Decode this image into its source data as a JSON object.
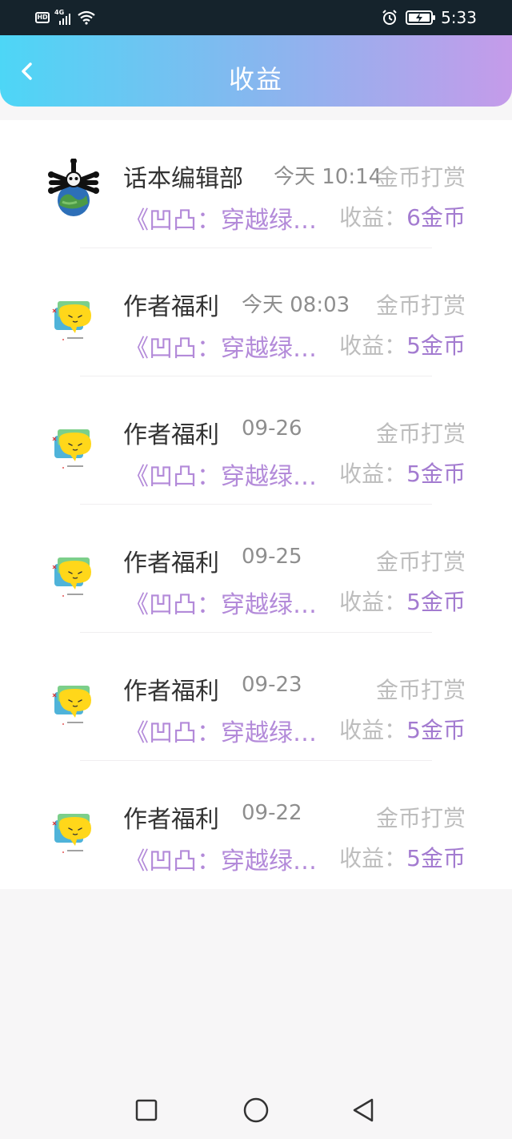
{
  "status_bar": {
    "hd_label": "HD",
    "network_label": "4G",
    "time": "5:33"
  },
  "header": {
    "title": "收益",
    "back_icon": "chevron-left-icon",
    "gradient": [
      "#4dd6f6",
      "#c59bea"
    ]
  },
  "rows": [
    {
      "name": "话本编辑部",
      "time": "今天 10:14",
      "type": "金币打赏",
      "book": "《凹凸：穿越绿林》",
      "income_label": "收益：",
      "income_amount": "6金币",
      "avatar": "skull-globe-avatar"
    },
    {
      "name": "作者福利",
      "time": "今天 08:03",
      "type": "金币打赏",
      "book": "《凹凸：穿越绿林》",
      "income_label": "收益：",
      "income_amount": "5金币",
      "avatar": "speech-bubble-avatar"
    },
    {
      "name": "作者福利",
      "time": "09-26",
      "type": "金币打赏",
      "book": "《凹凸：穿越绿林》",
      "income_label": "收益：",
      "income_amount": "5金币",
      "avatar": "speech-bubble-avatar"
    },
    {
      "name": "作者福利",
      "time": "09-25",
      "type": "金币打赏",
      "book": "《凹凸：穿越绿林》",
      "income_label": "收益：",
      "income_amount": "5金币",
      "avatar": "speech-bubble-avatar"
    },
    {
      "name": "作者福利",
      "time": "09-23",
      "type": "金币打赏",
      "book": "《凹凸：穿越绿林》",
      "income_label": "收益：",
      "income_amount": "5金币",
      "avatar": "speech-bubble-avatar"
    },
    {
      "name": "作者福利",
      "time": "09-22",
      "type": "金币打赏",
      "book": "《凹凸：穿越绿林》",
      "income_label": "收益：",
      "income_amount": "5金币",
      "avatar": "speech-bubble-avatar"
    }
  ],
  "nav_bar": {
    "buttons": [
      "recents-square-icon",
      "home-circle-icon",
      "back-triangle-icon"
    ]
  }
}
